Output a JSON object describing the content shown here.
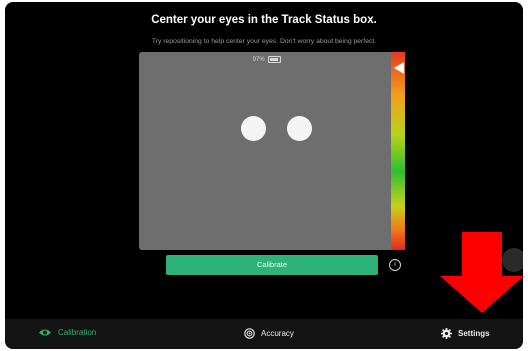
{
  "header": {
    "title": "Center your eyes in the Track Status box.",
    "subtitle": "Try repositioning to help center your eyes. Don't worry about being perfect."
  },
  "track_box": {
    "battery_text": "97%",
    "track_level_percent": 8
  },
  "calibrate_button": {
    "label": "Calibrate"
  },
  "info_icon_glyph": "i",
  "bottom_nav": {
    "items": [
      {
        "label": "Calibration",
        "icon": "eye-icon",
        "active": true
      },
      {
        "label": "Accuracy",
        "icon": "target-icon",
        "active": false
      },
      {
        "label": "Settings",
        "icon": "gear-icon",
        "active": false
      }
    ]
  },
  "colors": {
    "accent": "#2db37a",
    "background": "#000000",
    "track_box": "#6e6e6e",
    "annotation_arrow": "#ff0000"
  }
}
